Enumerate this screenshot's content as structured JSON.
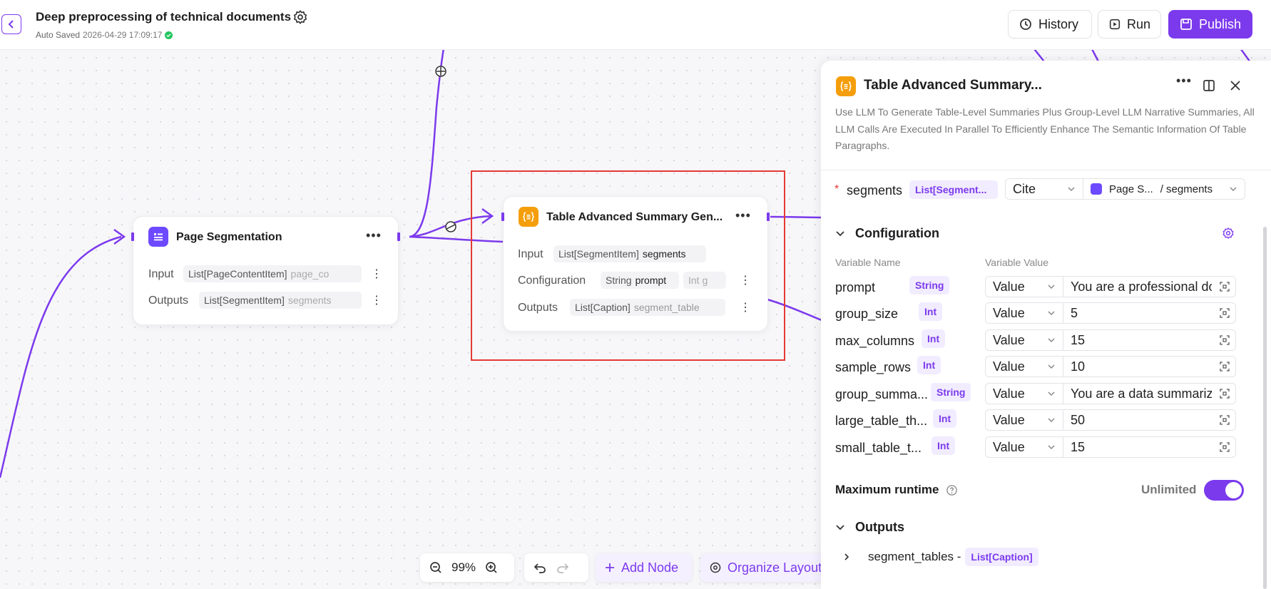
{
  "header": {
    "title": "Deep preprocessing of technical documents",
    "autosave_label": "Auto Saved",
    "autosave_time": "2026-04-29 17:09:17",
    "history_label": "History",
    "run_label": "Run",
    "publish_label": "Publish"
  },
  "nodes": {
    "page_segmentation": {
      "title": "Page Segmentation",
      "input_label": "Input",
      "input_type": "List[PageContentItem]",
      "input_var": "page_co",
      "outputs_label": "Outputs",
      "output_type": "List[SegmentItem]",
      "output_var": "segments"
    },
    "table_summary": {
      "title": "Table Advanced Summary Gen...",
      "input_label": "Input",
      "input_type": "List[SegmentItem]",
      "input_var": "segments",
      "config_label": "Configuration",
      "config_type": "String",
      "config_var": "prompt",
      "config_extra": "Int g",
      "outputs_label": "Outputs",
      "output_type": "List[Caption]",
      "output_var": "segment_table"
    }
  },
  "panel": {
    "title": "Table Advanced Summary...",
    "description": "Use LLM To Generate Table-Level Summaries Plus Group-Level LLM Narrative Summaries, All LLM Calls Are Executed In Parallel To Efficiently Enhance The Semantic Information Of Table Paragraphs.",
    "segments_label": "segments",
    "segments_type": "List[Segment...",
    "segments_mode": "Cite",
    "segments_source_node": "Page S...",
    "segments_source_var": "/ segments",
    "configuration_label": "Configuration",
    "col_name": "Variable Name",
    "col_value": "Variable Value",
    "variables": [
      {
        "name": "prompt",
        "type": "String",
        "mode": "Value",
        "value": "You are a professional do"
      },
      {
        "name": "group_size",
        "type": "Int",
        "mode": "Value",
        "value": "5"
      },
      {
        "name": "max_columns",
        "type": "Int",
        "mode": "Value",
        "value": "15"
      },
      {
        "name": "sample_rows",
        "type": "Int",
        "mode": "Value",
        "value": "10"
      },
      {
        "name": "group_summa...",
        "type": "String",
        "mode": "Value",
        "value": "You are a data summariza"
      },
      {
        "name": "large_table_th...",
        "type": "Int",
        "mode": "Value",
        "value": "50"
      },
      {
        "name": "small_table_t...",
        "type": "Int",
        "mode": "Value",
        "value": "15"
      }
    ],
    "runtime_label": "Maximum runtime",
    "runtime_value": "Unlimited",
    "runtime_toggle_on": true,
    "outputs_label": "Outputs",
    "output_name": "segment_tables -",
    "output_type": "List[Caption]"
  },
  "toolbar": {
    "zoom": "99%",
    "add_node_label": "Add Node",
    "organize_label": "Organize Layout"
  },
  "colors": {
    "accent": "#7c3aed",
    "selection": "#e53935",
    "node_icon_purple": "#6d4aff",
    "node_icon_orange": "#f59e0b"
  }
}
